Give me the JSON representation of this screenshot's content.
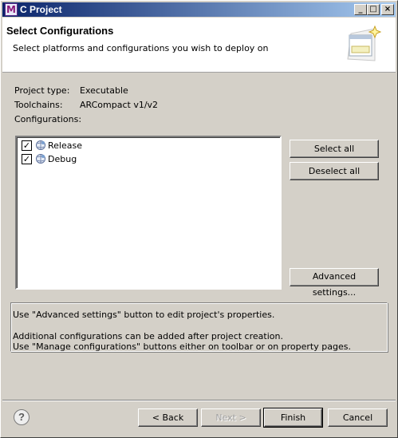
{
  "window": {
    "app_icon_letter": "M",
    "title": "C Project",
    "controls": {
      "minimize": "_",
      "maximize": "□",
      "close": "×"
    }
  },
  "header": {
    "title": "Select Configurations",
    "description": "Select platforms and configurations you wish to deploy on"
  },
  "info": {
    "project_type_label": "Project type:",
    "project_type_value": "Executable",
    "toolchains_label": "Toolchains:",
    "toolchains_value": "ARCompact v1/v2",
    "configurations_label": "Configurations:"
  },
  "configurations": [
    {
      "label": "Release",
      "checked": true
    },
    {
      "label": "Debug",
      "checked": true
    }
  ],
  "side_buttons": {
    "select_all": "Select all",
    "deselect_all": "Deselect all",
    "advanced_settings": "Advanced settings..."
  },
  "messages": {
    "line1": "Use \"Advanced settings\" button to edit project's properties.",
    "line2": "Additional configurations can be added after project creation.",
    "line3": "Use \"Manage configurations\" buttons either on toolbar or on property pages."
  },
  "footer": {
    "help": "?",
    "back": "< Back",
    "next": "Next >",
    "finish": "Finish",
    "cancel": "Cancel"
  },
  "icons": {
    "app": "app-icon",
    "config": "configuration-icon",
    "wizard": "wizard-banner-icon",
    "help": "help-icon"
  },
  "colors": {
    "titlebar_start": "#0a246a",
    "titlebar_end": "#a6caf0",
    "dialog_bg": "#d4d0c8"
  }
}
